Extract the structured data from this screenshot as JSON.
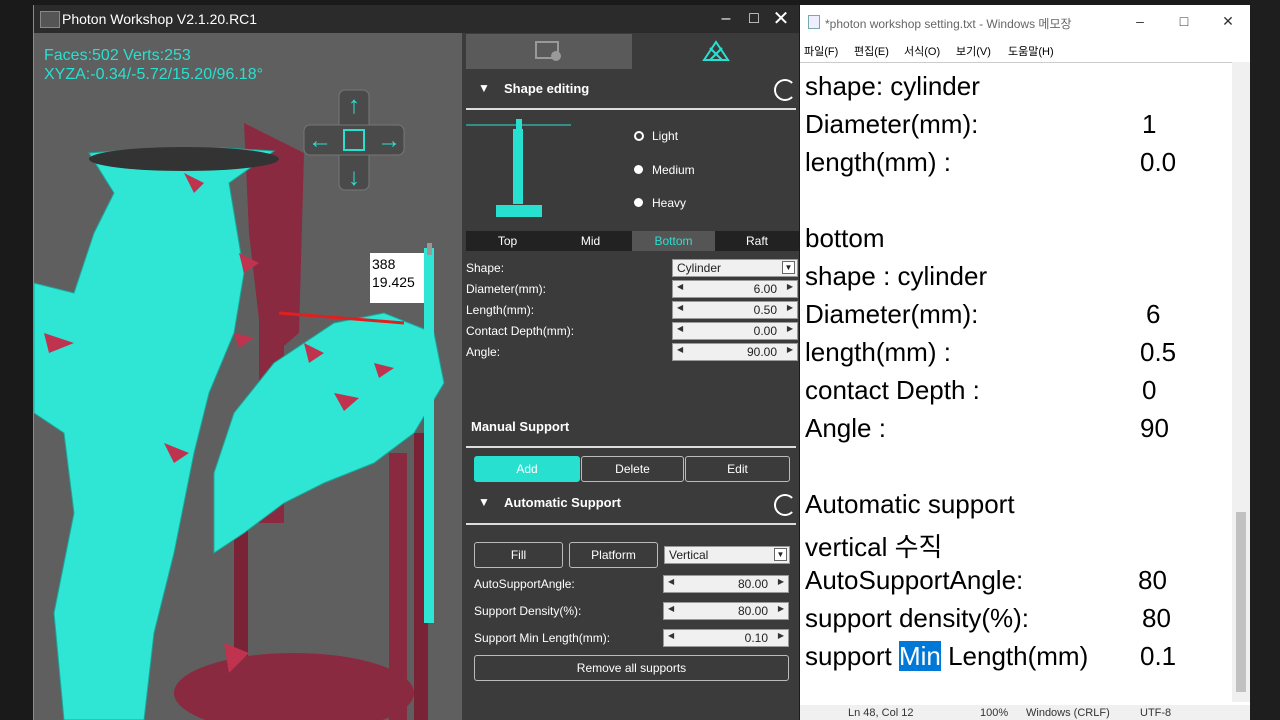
{
  "photon": {
    "title": "Photon Workshop V2.1.20.RC1",
    "viewport": {
      "faces_verts": "Faces:502  Verts:253",
      "xyza": "XYZA:-0.34/-5.72/15.20/96.18°",
      "tooltip_line1": "388",
      "tooltip_line2": "19.425"
    },
    "shape_editing": {
      "header": "Shape editing",
      "weights": [
        "Light",
        "Medium",
        "Heavy"
      ],
      "selected_weight": "Light",
      "segments": [
        "Top",
        "Mid",
        "Bottom",
        "Raft"
      ],
      "active_segment": "Bottom",
      "params": {
        "shape_label": "Shape:",
        "shape_value": "Cylinder",
        "diameter_label": "Diameter(mm):",
        "diameter_value": "6.00",
        "length_label": "Length(mm):",
        "length_value": "0.50",
        "contact_label": "Contact Depth(mm):",
        "contact_value": "0.00",
        "angle_label": "Angle:",
        "angle_value": "90.00"
      }
    },
    "manual_support": {
      "header": "Manual Support",
      "add": "Add",
      "delete": "Delete",
      "edit": "Edit"
    },
    "automatic_support": {
      "header": "Automatic Support",
      "fill": "Fill",
      "platform": "Platform",
      "mode": "Vertical",
      "angle_label": "AutoSupportAngle:",
      "angle_value": "80.00",
      "density_label": "Support Density(%):",
      "density_value": "80.00",
      "minlen_label": "Support Min Length(mm):",
      "minlen_value": "0.10",
      "remove_all": "Remove all supports"
    }
  },
  "notepad": {
    "title": "*photon workshop setting.txt - Windows 메모장",
    "menu": [
      "파일(F)",
      "편집(E)",
      "서식(O)",
      "보기(V)",
      "도움말(H)"
    ],
    "lines": {
      "l1": "shape: cylinder",
      "l2a": "Diameter(mm):",
      "l2b": "1",
      "l3a": "length(mm) :",
      "l3b": "0.0",
      "l4": "bottom",
      "l5": "shape : cylinder",
      "l6a": "Diameter(mm):",
      "l6b": "6",
      "l7a": "length(mm) :",
      "l7b": "0.5",
      "l8a": "contact Depth :",
      "l8b": "0",
      "l9a": "Angle :",
      "l9b": "90",
      "l10": "Automatic support",
      "l11": "vertical 수직",
      "l12a": "AutoSupportAngle:",
      "l12b": "80",
      "l13a": "support density(%):",
      "l13b": "80",
      "l14a": "support ",
      "l14hl": "Min",
      "l14c": " Length(mm)",
      "l14d": "0.1"
    },
    "status": {
      "position": "Ln 48, Col 12",
      "zoom": "100%",
      "eol": "Windows (CRLF)",
      "encoding": "UTF-8"
    }
  },
  "colors": {
    "accent": "#28e0d0",
    "model": "#2fe6d4",
    "support": "#8a2a40"
  }
}
